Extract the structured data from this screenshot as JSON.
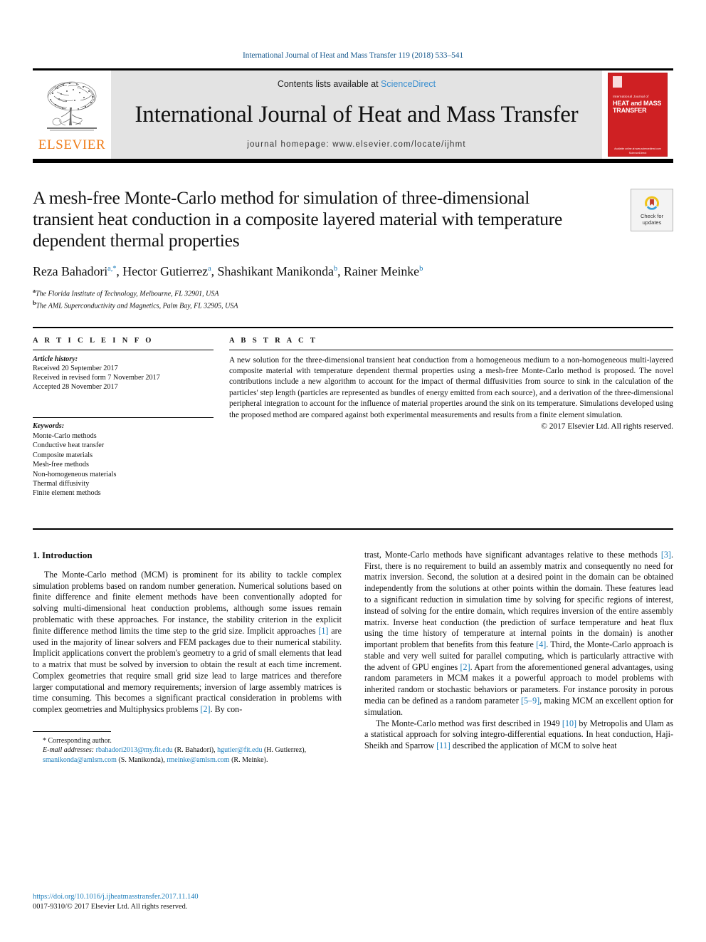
{
  "running_head": "International Journal of Heat and Mass Transfer 119 (2018) 533–541",
  "masthead": {
    "contents_prefix": "Contents lists available at ",
    "sciencedirect": "ScienceDirect",
    "journal_title": "International Journal of Heat and Mass Transfer",
    "homepage": "journal homepage: www.elsevier.com/locate/ijhmt",
    "publisher_name": "ELSEVIER",
    "cover": {
      "line1": "International Journal of",
      "line2": "HEAT and MASS",
      "line3": "TRANSFER",
      "footer1": "Available online at www.sciencedirect.com",
      "footer2": "ScienceDirect"
    },
    "accent_blue": "#3a8fd0",
    "elsevier_orange": "#ef7d1a",
    "cover_red": "#cf2023",
    "band_gray": "#e3e3e3"
  },
  "crossmark": {
    "line1": "Check for",
    "line2": "updates"
  },
  "title": "A mesh-free Monte-Carlo method for simulation of three-dimensional transient heat conduction in a composite layered material with temperature dependent thermal properties",
  "authors": [
    {
      "name": "Reza Bahadori",
      "sup": "a,*"
    },
    {
      "name": "Hector Gutierrez",
      "sup": "a"
    },
    {
      "name": "Shashikant Manikonda",
      "sup": "b"
    },
    {
      "name": "Rainer Meinke",
      "sup": "b"
    }
  ],
  "affiliations": [
    {
      "marker": "a",
      "text": "The Florida Institute of Technology, Melbourne, FL 32901, USA"
    },
    {
      "marker": "b",
      "text": "The AML Superconductivity and Magnetics, Palm Bay, FL 32905, USA"
    }
  ],
  "article_info": {
    "label": "A R T I C L E  I N F O",
    "history_label": "Article history:",
    "history": [
      "Received 20 September 2017",
      "Received in revised form 7 November 2017",
      "Accepted 28 November 2017"
    ],
    "keywords_label": "Keywords:",
    "keywords": [
      "Monte-Carlo methods",
      "Conductive heat transfer",
      "Composite materials",
      "Mesh-free methods",
      "Non-homogeneous materials",
      "Thermal diffusivity",
      "Finite element methods"
    ]
  },
  "abstract": {
    "label": "A B S T R A C T",
    "text": "A new solution for the three-dimensional transient heat conduction from a homogeneous medium to a non-homogeneous multi-layered composite material with temperature dependent thermal properties using a mesh-free Monte-Carlo method is proposed. The novel contributions include a new algorithm to account for the impact of thermal diffusivities from source to sink in the calculation of the particles' step length (particles are represented as bundles of energy emitted from each source), and a derivation of the three-dimensional peripheral integration to account for the influence of material properties around the sink on its temperature. Simulations developed using the proposed method are compared against both experimental measurements and results from a finite element simulation.",
    "copyright": "© 2017 Elsevier Ltd. All rights reserved."
  },
  "body": {
    "section_title": "1. Introduction",
    "left_paragraph_1_a": "The Monte-Carlo method (MCM) is prominent for its ability to tackle complex simulation problems based on random number generation. Numerical solutions based on finite difference and finite element methods have been conventionally adopted for solving multi-dimensional heat conduction problems, although some issues remain problematic with these approaches. For instance, the stability criterion in the explicit finite difference method limits the time step to the grid size. Implicit approaches ",
    "ref_1": "[1]",
    "left_paragraph_1_b": " are used in the majority of linear solvers and FEM packages due to their numerical stability. Implicit applications convert the problem's geometry to a grid of small elements that lead to a matrix that must be solved by inversion to obtain the result at each time increment. Complex geometries that require small grid size lead to large matrices and therefore larger computational and memory requirements; inversion of large assembly matrices is time consuming. This becomes a significant practical consideration in problems with complex geometries and Multiphysics problems ",
    "ref_2": "[2]",
    "left_paragraph_1_c": ". By con-",
    "right_paragraph_1_a": "trast, Monte-Carlo methods have significant advantages relative to these methods ",
    "ref_3": "[3]",
    "right_paragraph_1_b": ". First, there is no requirement to build an assembly matrix and consequently no need for matrix inversion. Second, the solution at a desired point in the domain can be obtained independently from the solutions at other points within the domain. These features lead to a significant reduction in simulation time by solving for specific regions of interest, instead of solving for the entire domain, which requires inversion of the entire assembly matrix. Inverse heat conduction (the prediction of surface temperature and heat flux using the time history of temperature at internal points in the domain) is another important problem that benefits from this feature ",
    "ref_4": "[4]",
    "right_paragraph_1_c": ". Third, the Monte-Carlo approach is stable and very well suited for parallel computing, which is particularly attractive with the advent of GPU engines ",
    "ref_2b": "[2]",
    "right_paragraph_1_d": ". Apart from the aforementioned general advantages, using random parameters in MCM makes it a powerful approach to model problems with inherited random or stochastic behaviors or parameters. For instance porosity in porous media can be defined as a random parameter ",
    "ref_59": "[5–9]",
    "right_paragraph_1_e": ", making MCM an excellent option for simulation.",
    "right_paragraph_2_a": "The Monte-Carlo method was first described in 1949 ",
    "ref_10": "[10]",
    "right_paragraph_2_b": " by Metropolis and Ulam as a statistical approach for solving integro-differential equations. In heat conduction, Haji-Sheikh and Sparrow ",
    "ref_11": "[11]",
    "right_paragraph_2_c": " described the application of MCM to solve heat"
  },
  "footnote": {
    "star": "*",
    "corresponding": "Corresponding author.",
    "email_label": "E-mail addresses:",
    "emails": [
      {
        "address": "rbahadori2013@my.fit.edu",
        "owner": "(R. Bahadori),"
      },
      {
        "address": "hgutier@fit.edu",
        "owner": "(H. Gutierrez),"
      },
      {
        "address": "smanikonda@amlsm.com",
        "owner": "(S. Manikonda),"
      },
      {
        "address": "rmeinke@amlsm.com",
        "owner": "(R. Meinke)."
      }
    ]
  },
  "footer": {
    "doi": "https://doi.org/10.1016/j.ijheatmasstransfer.2017.11.140",
    "issn": "0017-9310/© 2017 Elsevier Ltd. All rights reserved.",
    "link_blue": "#1a7bb9"
  }
}
